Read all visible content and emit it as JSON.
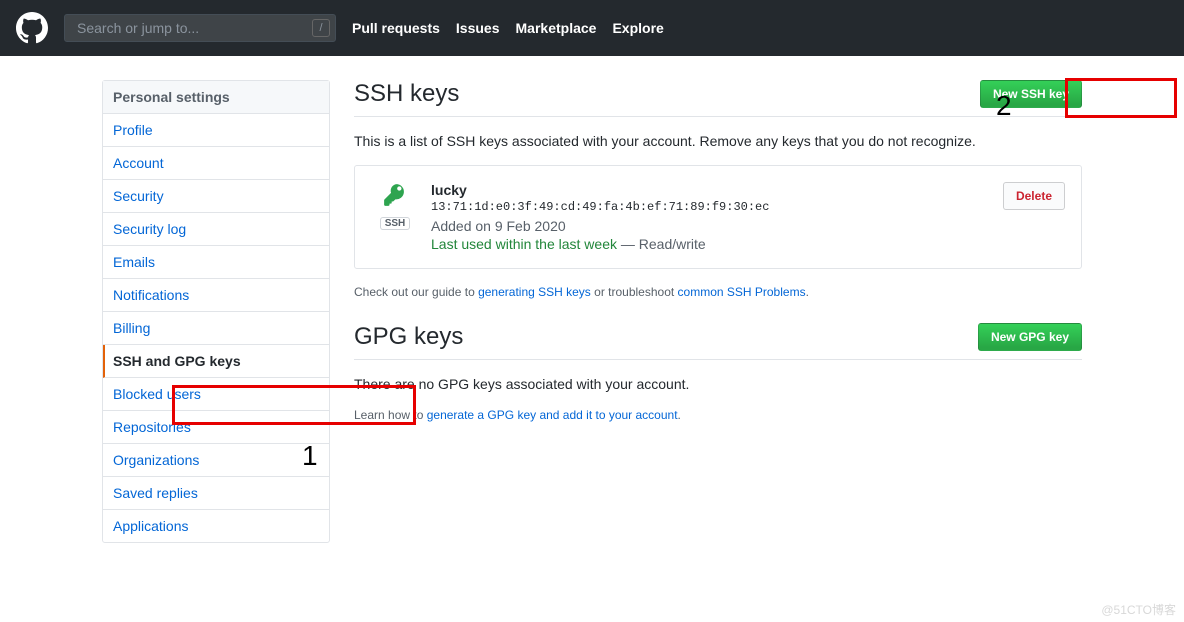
{
  "header": {
    "search_placeholder": "Search or jump to...",
    "slash": "/",
    "nav": [
      "Pull requests",
      "Issues",
      "Marketplace",
      "Explore"
    ]
  },
  "sidebar": {
    "title": "Personal settings",
    "items": [
      {
        "label": "Profile",
        "current": false
      },
      {
        "label": "Account",
        "current": false
      },
      {
        "label": "Security",
        "current": false
      },
      {
        "label": "Security log",
        "current": false
      },
      {
        "label": "Emails",
        "current": false
      },
      {
        "label": "Notifications",
        "current": false
      },
      {
        "label": "Billing",
        "current": false
      },
      {
        "label": "SSH and GPG keys",
        "current": true
      },
      {
        "label": "Blocked users",
        "current": false
      },
      {
        "label": "Repositories",
        "current": false
      },
      {
        "label": "Organizations",
        "current": false
      },
      {
        "label": "Saved replies",
        "current": false
      },
      {
        "label": "Applications",
        "current": false
      }
    ]
  },
  "ssh": {
    "heading": "SSH keys",
    "new_btn": "New SSH key",
    "intro": "This is a list of SSH keys associated with your account. Remove any keys that you do not recognize.",
    "key": {
      "name": "lucky",
      "fingerprint": "13:71:1d:e0:3f:49:cd:49:fa:4b:ef:71:89:f9:30:ec",
      "added": "Added on 9 Feb 2020",
      "last_used": "Last used within the last week",
      "sep": " — ",
      "access": "Read/write",
      "badge": "SSH",
      "delete": "Delete"
    },
    "help_prefix": "Check out our guide to ",
    "help_link1": "generating SSH keys",
    "help_mid": " or troubleshoot ",
    "help_link2": "common SSH Problems",
    "help_suffix": "."
  },
  "gpg": {
    "heading": "GPG keys",
    "new_btn": "New GPG key",
    "intro": "There are no GPG keys associated with your account.",
    "help_prefix": "Learn how to ",
    "help_link": "generate a GPG key and add it to your account",
    "help_suffix": "."
  },
  "annotations": {
    "num1": "1",
    "num2": "2"
  },
  "watermark": "@51CTO博客"
}
